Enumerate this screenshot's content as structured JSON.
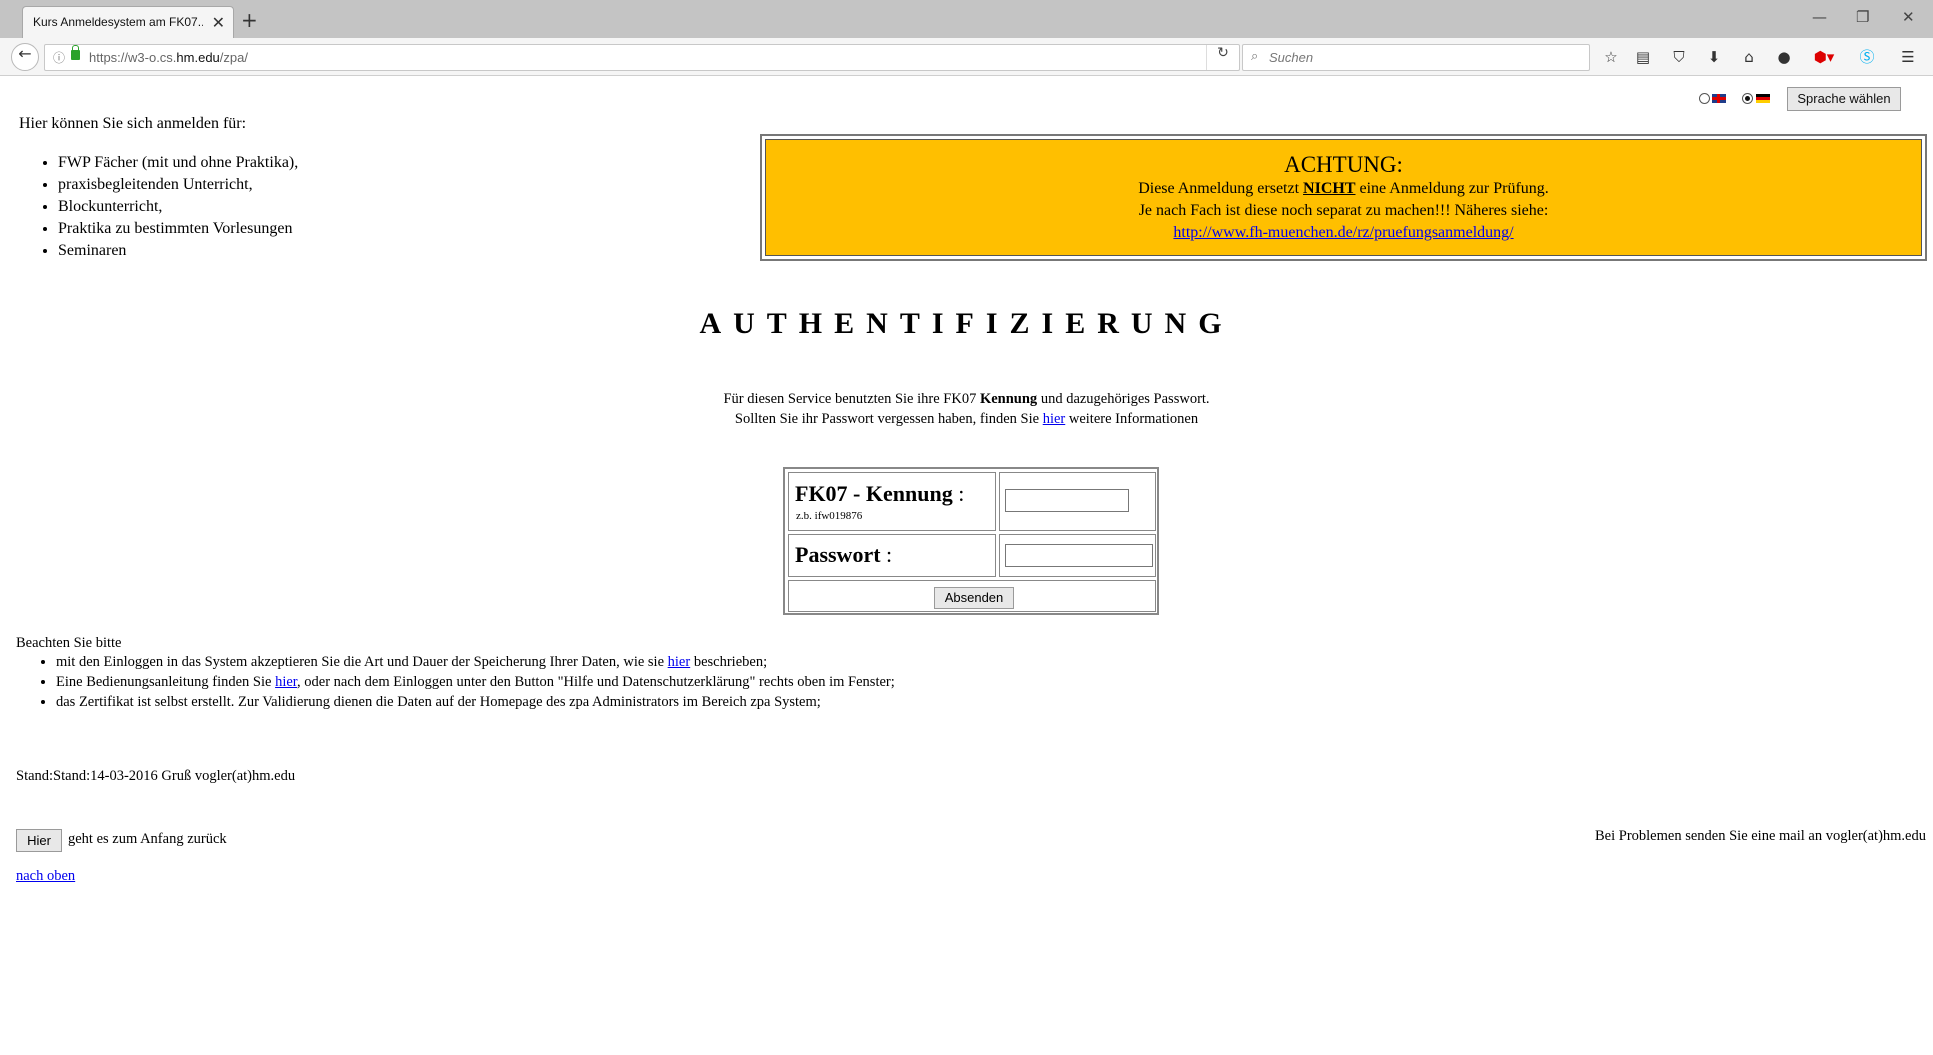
{
  "browser": {
    "tab_title": "Kurs Anmeldesystem am FK07...",
    "tab_close": "✕",
    "new_tab": "+",
    "window_controls": [
      "—",
      "❐",
      "✕"
    ],
    "url_prefix": "https://w3-o.cs.",
    "url_domain": "hm.edu",
    "url_path": "/zpa/",
    "search_placeholder": "Suchen",
    "toolbar_icons": [
      "bookmark-star-icon",
      "reading-list-icon",
      "pocket-icon",
      "download-icon",
      "home-icon",
      "chat-icon",
      "adblock-icon",
      "skype-icon",
      "menu-icon"
    ]
  },
  "lang": {
    "button": "Sprache wählen"
  },
  "intro": {
    "heading": "Hier können Sie sich anmelden für:",
    "items": [
      "FWP Fächer (mit und ohne Praktika),",
      "praxisbegleitenden Unterricht,",
      "Blockunterricht,",
      "Praktika zu bestimmten Vorlesungen",
      "Seminaren"
    ]
  },
  "warning": {
    "title": "ACHTUNG:",
    "line1_pre": "Diese Anmeldung ersetzt ",
    "line1_bold": "NICHT",
    "line1_post": " eine Anmeldung zur Prüfung.",
    "line2": "Je nach Fach ist diese noch separat zu machen!!! Näheres siehe:",
    "link": "http://www.fh-muenchen.de/rz/pruefungsanmeldung/",
    "color": "#ffbf00"
  },
  "auth": {
    "title": "AUTHENTIFIZIERUNG",
    "line1_pre": "Für diesen Service benutzten Sie ihre FK07 ",
    "line1_bold": "Kennung",
    "line1_post": " und dazugehöriges Passwort.",
    "line2_pre": "Sollten Sie ihr Passwort vergessen haben, finden Sie ",
    "line2_link": "hier",
    "line2_post": " weitere Informationen"
  },
  "login": {
    "user_label": "FK07 - Kennung",
    "user_colon": " :",
    "user_hint": "z.b. ifw019876",
    "user_value": "",
    "pass_label": "Passwort",
    "pass_colon": " :",
    "pass_value": "",
    "submit": "Absenden"
  },
  "notes": {
    "title": "Beachten Sie bitte",
    "item1_pre": "mit den Einloggen in das System akzeptieren Sie die Art und Dauer der Speicherung Ihrer Daten, wie sie ",
    "item1_link": "hier",
    "item1_post": " beschrieben;",
    "item2_pre": "Eine Bedienungsanleitung finden Sie ",
    "item2_link": "hier",
    "item2_post": ", oder nach dem Einloggen unter den Button \"Hilfe und Datenschutzerklärung\" rechts oben im Fenster;",
    "item3": "das Zertifikat ist selbst erstellt. Zur Validierung dienen die Daten auf der Homepage des zpa Administrators im Bereich zpa System;"
  },
  "footer": {
    "stand": "Stand:Stand:14-03-2016 Gruß vogler(at)hm.edu",
    "hier_button": "Hier",
    "back_text": "geht es zum Anfang zurück",
    "problems": "Bei Problemen senden Sie eine mail an vogler(at)hm.edu",
    "top_link": "nach oben"
  }
}
